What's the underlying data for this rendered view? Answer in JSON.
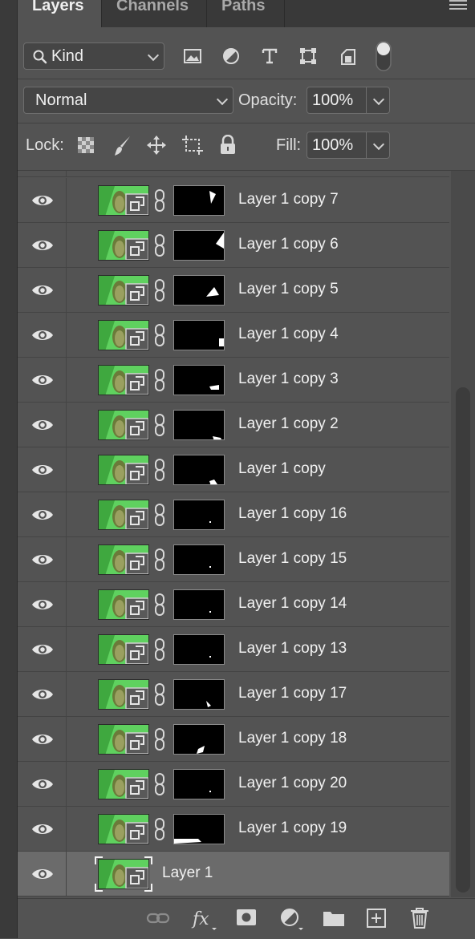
{
  "tabs": [
    {
      "label": "Layers",
      "active": true
    },
    {
      "label": "Channels",
      "active": false
    },
    {
      "label": "Paths",
      "active": false
    }
  ],
  "filter": {
    "label": "Kind",
    "icons": [
      "image-filter-icon",
      "adjustment-filter-icon",
      "type-filter-icon",
      "shape-filter-icon",
      "smart-object-filter-icon",
      "filter-toggle-icon"
    ]
  },
  "blend": {
    "mode": "Normal",
    "opacity_label": "Opacity:",
    "opacity_value": "100%"
  },
  "lock": {
    "label": "Lock:",
    "icons": [
      "lock-transparent-pixels-icon",
      "lock-image-pixels-icon",
      "lock-position-icon",
      "lock-artboard-icon",
      "lock-all-icon"
    ],
    "fill_label": "Fill:",
    "fill_value": "100%"
  },
  "layers": [
    {
      "name": "Layer 1 copy 7",
      "mask": "tri-top-right"
    },
    {
      "name": "Layer 1 copy 6",
      "mask": "tri-right-edge"
    },
    {
      "name": "Layer 1 copy 5",
      "mask": "tri-mid-right"
    },
    {
      "name": "Layer 1 copy 4",
      "mask": "small-right"
    },
    {
      "name": "Layer 1 copy 3",
      "mask": "blob-low-right"
    },
    {
      "name": "Layer 1 copy 2",
      "mask": "blob-bottom-right"
    },
    {
      "name": "Layer 1 copy",
      "mask": "blob-bottom-mid"
    },
    {
      "name": "Layer 1 copy 16",
      "mask": "dot"
    },
    {
      "name": "Layer 1 copy 15",
      "mask": "dot"
    },
    {
      "name": "Layer 1 copy 14",
      "mask": "dot"
    },
    {
      "name": "Layer 1 copy 13",
      "mask": "dot"
    },
    {
      "name": "Layer 1 copy 17",
      "mask": "blob-mid-low"
    },
    {
      "name": "Layer 1 copy 18",
      "mask": "blob-left-low"
    },
    {
      "name": "Layer 1 copy 20",
      "mask": "dot"
    },
    {
      "name": "Layer 1 copy 19",
      "mask": "bar-bottom-left"
    },
    {
      "name": "Layer 1",
      "mask": "none",
      "selected": true
    }
  ],
  "bottom_toolbar": [
    "link-layers-icon",
    "fx-icon",
    "add-mask-icon",
    "adjustment-layer-icon",
    "new-group-icon",
    "new-layer-icon",
    "trash-icon"
  ],
  "colors": {
    "panel": "#535353",
    "selected_row": "#6b6b6b",
    "tab_bar": "#393939"
  }
}
